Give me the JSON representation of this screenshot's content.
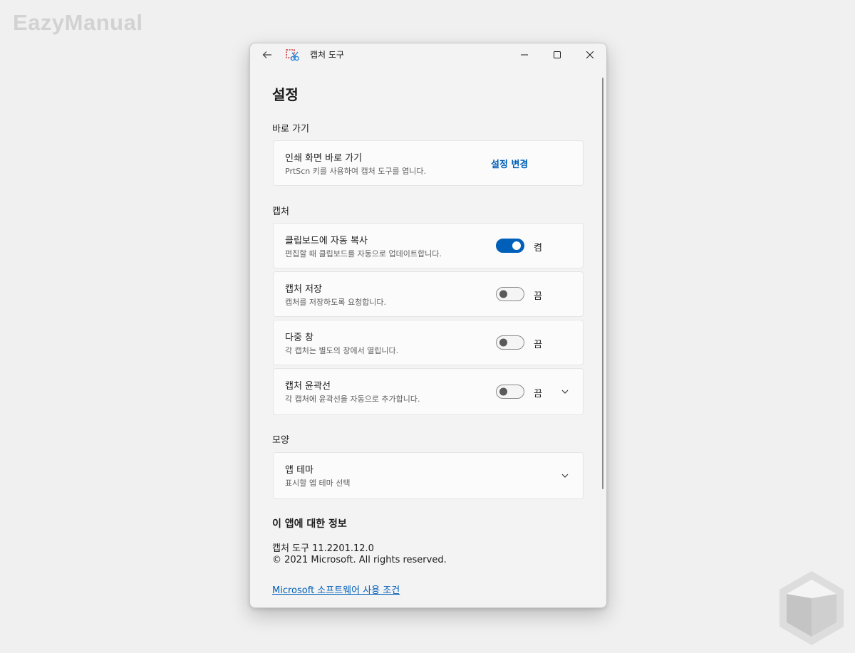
{
  "watermark": "EazyManual",
  "window": {
    "title": "캡처 도구"
  },
  "page": {
    "title": "설정"
  },
  "shortcut": {
    "header": "바로 가기",
    "print_screen": {
      "title": "인쇄 화면 바로 가기",
      "desc": "PrtScn 키를 사용하여 캡처 도구를 엽니다.",
      "action_label": "설정 변경"
    }
  },
  "capture": {
    "header": "캡처",
    "items": [
      {
        "title": "클립보드에 자동 복사",
        "desc": "편집할 때 클립보드를 자동으로 업데이트합니다.",
        "state": "켬",
        "on": true
      },
      {
        "title": "캡처 저장",
        "desc": "캡처를 저장하도록 요청합니다.",
        "state": "끔",
        "on": false
      },
      {
        "title": "다중 창",
        "desc": "각 캡처는 별도의 창에서 열립니다.",
        "state": "끔",
        "on": false
      },
      {
        "title": "캡처 윤곽선",
        "desc": "각 캡처에 윤곽선을 자동으로 추가합니다.",
        "state": "끔",
        "on": false
      }
    ]
  },
  "appearance": {
    "header": "모양",
    "theme": {
      "title": "앱 테마",
      "desc": "표시할 앱 테마 선택"
    }
  },
  "about": {
    "title": "이 앱에 대한 정보",
    "version": "캡처 도구 11.2201.12.0",
    "copyright": "© 2021 Microsoft. All rights reserved.",
    "terms_link": "Microsoft 소프트웨어 사용 조건"
  },
  "colors": {
    "accent": "#005fb8",
    "background": "#f0f0f0",
    "card": "#fbfbfb"
  },
  "icons": {
    "back": "arrow-left-icon",
    "app": "snipping-tool-icon",
    "minimize": "minimize-icon",
    "maximize": "maximize-icon",
    "close": "close-icon",
    "expand": "chevron-down-icon"
  }
}
